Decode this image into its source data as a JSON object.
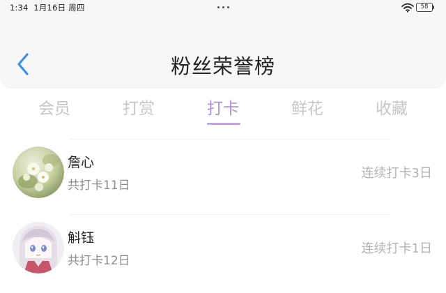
{
  "status_bar": {
    "time": "1:34",
    "date": "1月16日 周四",
    "battery": "58"
  },
  "header": {
    "title": "粉丝荣誉榜",
    "back_icon": "chevron-left-icon",
    "accent_color": "#3d8ee8"
  },
  "tabs": [
    {
      "label": "会员",
      "active": false
    },
    {
      "label": "打赏",
      "active": false
    },
    {
      "label": "打卡",
      "active": true
    },
    {
      "label": "鲜花",
      "active": false
    },
    {
      "label": "收藏",
      "active": false
    }
  ],
  "active_tab_color": "#b28fd3",
  "members": [
    {
      "name": "詹心",
      "total": "共打卡11日",
      "streak": "连续打卡3日"
    },
    {
      "name": "斛钰",
      "total": "共打卡12日",
      "streak": "连续打卡1日"
    }
  ]
}
